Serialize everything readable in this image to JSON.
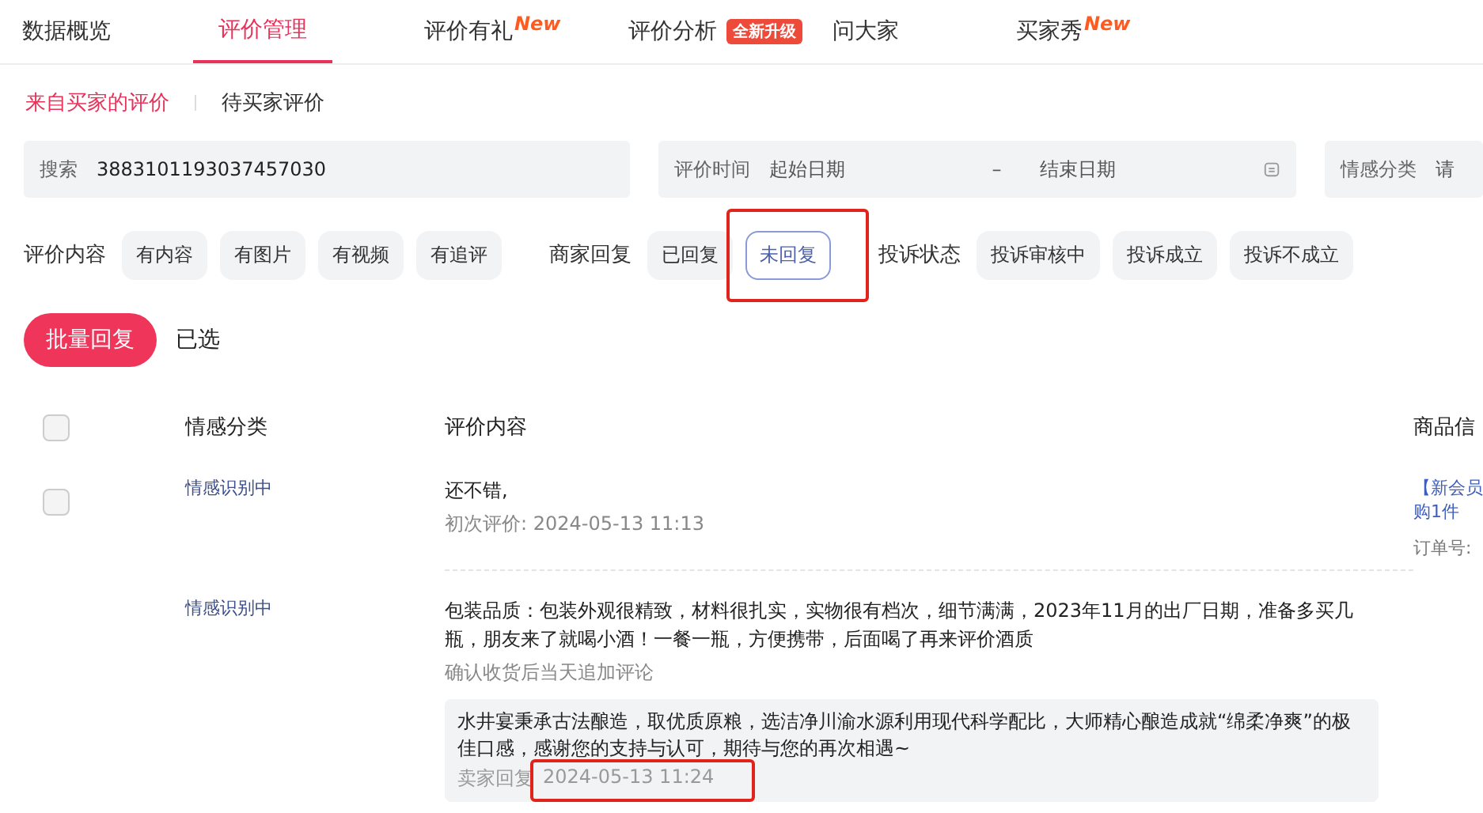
{
  "tabs": [
    {
      "label": "数据概览",
      "selected": false
    },
    {
      "label": "评价管理",
      "selected": true
    },
    {
      "label": "评价有礼",
      "selected": false,
      "badge": {
        "kind": "new",
        "text": "New"
      }
    },
    {
      "label": "评价分析",
      "selected": false,
      "badge": {
        "kind": "pill",
        "text": "全新升级"
      }
    },
    {
      "label": "问大家",
      "selected": false
    },
    {
      "label": "买家秀",
      "selected": false,
      "badge": {
        "kind": "new",
        "text": "New"
      }
    }
  ],
  "sub_tabs": [
    {
      "label": "来自买家的评价",
      "selected": true
    },
    {
      "label": "待买家评价",
      "selected": false
    }
  ],
  "filters": {
    "search": {
      "label": "搜索",
      "value": "3883101193037457030"
    },
    "date": {
      "label": "评价时间",
      "start_placeholder": "起始日期",
      "separator": "–",
      "end_placeholder": "结束日期"
    },
    "sentiment": {
      "label": "情感分类",
      "placeholder": "请"
    }
  },
  "chip_groups": [
    {
      "label": "评价内容",
      "chips": [
        {
          "label": "有内容",
          "selected": false,
          "highlighted": false
        },
        {
          "label": "有图片",
          "selected": false,
          "highlighted": false
        },
        {
          "label": "有视频",
          "selected": false,
          "highlighted": false
        },
        {
          "label": "有追评",
          "selected": false,
          "highlighted": false
        }
      ]
    },
    {
      "label": "商家回复",
      "chips": [
        {
          "label": "已回复",
          "selected": false,
          "highlighted": false
        },
        {
          "label": "未回复",
          "selected": true,
          "highlighted": true
        }
      ]
    },
    {
      "label": "投诉状态",
      "chips": [
        {
          "label": "投诉审核中",
          "selected": false,
          "highlighted": false
        },
        {
          "label": "投诉成立",
          "selected": false,
          "highlighted": false
        },
        {
          "label": "投诉不成立",
          "selected": false,
          "highlighted": false
        }
      ]
    }
  ],
  "batch_button": "批量回复",
  "selected_label": "已选",
  "select_all_checked": false,
  "table": {
    "columns": [
      "情感分类",
      "评价内容",
      "商品信"
    ],
    "rows": [
      {
        "checked": false,
        "sentiment": "情感识别中",
        "review": "还不错,",
        "review_time": "初次评价: 2024-05-13 11:13",
        "product_lines": [
          "【新会员",
          "购1件"
        ],
        "order_label": "订单号:"
      },
      {
        "sentiment": "情感识别中",
        "review": "包装品质：包装外观很精致，材料很扎实，实物很有档次，细节满满，2023年11月的出厂日期，准备多买几瓶，朋友来了就喝小酒！一餐一瓶，方便携带，后面喝了再来评价酒质",
        "review_time": "确认收货后当天追加评论",
        "reply": {
          "text": "水井宴秉承古法酿造，取优质原粮，选洁净川渝水源利用现代科学配比，大师精心酿造成就“绵柔净爽”的极佳口感，感谢您的支持与认可，期待与您的再次相遇~",
          "label": "卖家回复",
          "time": "2024-05-13 11:24",
          "highlighted": true
        }
      }
    ]
  }
}
